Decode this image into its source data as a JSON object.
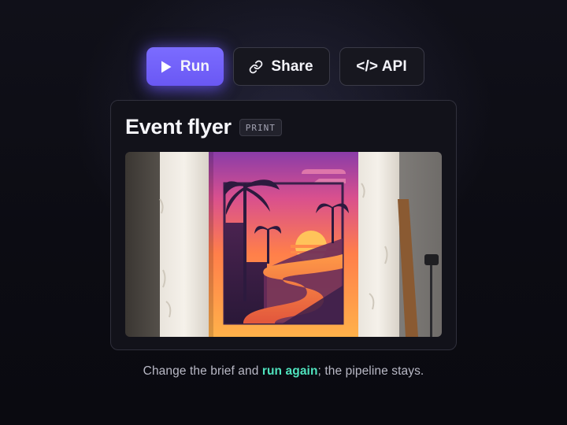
{
  "toolbar": {
    "run_label": "Run",
    "share_label": "Share",
    "api_label": "</> API",
    "icons": {
      "run": "play-icon",
      "share": "link-icon"
    },
    "accent_color": "#6e5cf6"
  },
  "card": {
    "title": "Event flyer",
    "badge": "PRINT",
    "image": {
      "subject": "sunset-palm-poster-on-wall",
      "palette": [
        "#7c3aa8",
        "#e8508a",
        "#ff7a3c",
        "#ffb347",
        "#2f1f4a"
      ]
    }
  },
  "caption": {
    "before": "Change the brief and ",
    "highlight": "run again",
    "after": "; the pipeline stays.",
    "highlight_color": "#4fe3be"
  }
}
